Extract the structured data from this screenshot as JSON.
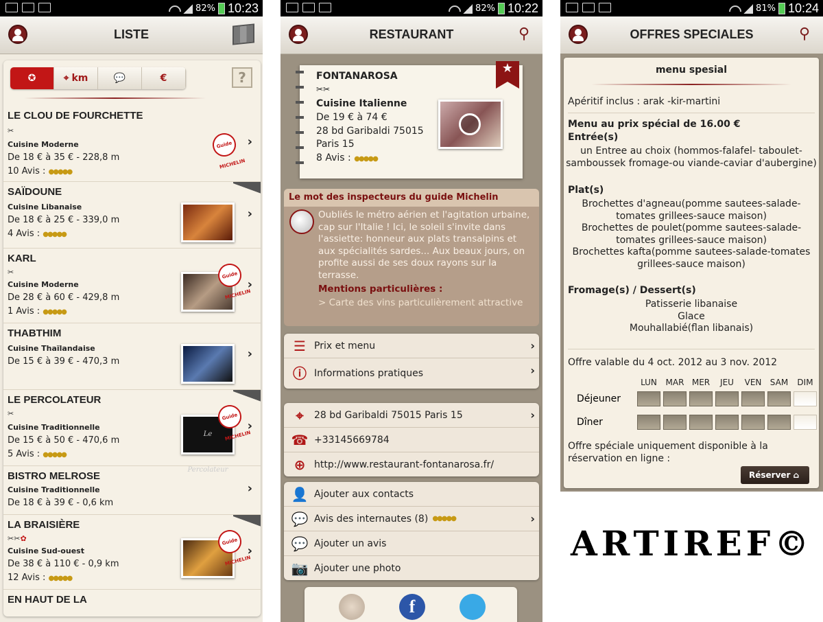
{
  "screen1": {
    "status": {
      "battery": "82%",
      "time": "10:23"
    },
    "title": "LISTE",
    "filters": {
      "distance_label": "km"
    },
    "restaurants": [
      {
        "name": "LE CLOU DE FOURCHETTE",
        "forks": "✂",
        "cuisine": "Cuisine Moderne",
        "price": "De 18 € à 35 €  - 228,8 m",
        "avis": "10 Avis :"
      },
      {
        "name": "SAÏDOUNE",
        "cuisine": "Cuisine Libanaise",
        "price": "De 18 € à 25 €  - 339,0 m",
        "avis": "4 Avis :"
      },
      {
        "name": "KARL",
        "forks": "✂",
        "cuisine": "Cuisine Moderne",
        "price": "De 28 € à 60 €  - 429,8 m",
        "avis": "1 Avis :"
      },
      {
        "name": "THABTHIM",
        "cuisine": "Cuisine Thaïlandaise",
        "price": "De 15 € à 39 €  - 470,3 m"
      },
      {
        "name": "LE PERCOLATEUR",
        "forks": "✂",
        "cuisine": "Cuisine Traditionnelle",
        "price": "De 15 € à 50 €  - 470,6 m",
        "avis": "5 Avis :",
        "thumb_text": "Le Percolateur"
      },
      {
        "name": "BISTRO MELROSE",
        "cuisine": "Cuisine Traditionnelle",
        "price": "De 18 € à 39 €  - 0,6 km"
      },
      {
        "name": "LA BRAISIÈRE",
        "forks": "✂✂",
        "cuisine": "Cuisine Sud-ouest",
        "price": "De 38 € à 110 €  - 0,9 km",
        "avis": "12 Avis :"
      },
      {
        "name": "EN HAUT DE LA"
      }
    ],
    "michelin_label": "Guide MICHELIN"
  },
  "screen2": {
    "status": {
      "battery": "82%",
      "time": "10:22"
    },
    "title": "RESTAURANT",
    "card": {
      "name": "FONTANAROSA",
      "forks": "✂✂",
      "cuisine": "Cuisine Italienne",
      "price": "De 19 € à 74 €",
      "address1": "28 bd Garibaldi 75015",
      "address2": "Paris 15",
      "avis": "8 Avis :"
    },
    "inspect": {
      "header": "Le mot des inspecteurs du guide Michelin",
      "text": "Oubliés le métro aérien et l'agitation urbaine, cap sur l'Italie ! Ici, le soleil s'invite dans l'assiette: honneur aux plats transalpins et aux spécialités sardes... Aux beaux jours, on profite aussi de ses doux rayons sur la terrasse.",
      "mentions_title": "Mentions particulières :",
      "mention": "> Carte des vins particulièrement attractive"
    },
    "menu_rows": [
      "Prix et menu",
      "Informations pratiques"
    ],
    "contact_rows": [
      "28 bd Garibaldi 75015 Paris 15",
      "+33145669784",
      "http://www.restaurant-fontanarosa.fr/"
    ],
    "action_rows": [
      "Ajouter aux contacts",
      "Avis des internautes (8)",
      "Ajouter un avis",
      "Ajouter une photo"
    ]
  },
  "screen3": {
    "status": {
      "battery": "81%",
      "time": "10:24"
    },
    "title": "OFFRES SPECIALES",
    "menu_title": "menu spesial",
    "aperitif": "Apéritif inclus : arak -kir-martini",
    "menu_price": "Menu au prix spécial de 16.00 €",
    "entrees_title": "Entrée(s)",
    "entrees": [
      "un Entree au choix (hommos-falafel- taboulet-",
      "samboussek fromage-ou viande-caviar d'aubergine)"
    ],
    "plats_title": "Plat(s)",
    "plats": [
      "Brochettes d'agneau(pomme sautees-salade-",
      "tomates grillees-sauce maison)",
      "Brochettes de poulet(pomme sautees-salade-",
      "tomates grillees-sauce maison)",
      "Brochettes kafta(pomme sautees-salade-tomates",
      "grillees-sauce maison)"
    ],
    "desserts_title": "Fromage(s) / Dessert(s)",
    "desserts": [
      "Patisserie libanaise",
      "Glace",
      "Mouhallabié(flan libanais)"
    ],
    "validity": "Offre valable du 4 oct. 2012 au 3 nov. 2012",
    "days": [
      "LUN",
      "MAR",
      "MER",
      "JEU",
      "VEN",
      "SAM",
      "DIM"
    ],
    "meals": [
      "Déjeuner",
      "Dîner"
    ],
    "note": "Offre spéciale uniquement disponible à la réservation en ligne :",
    "reserve_label": "Réserver"
  },
  "watermark": "ARTIREF©",
  "colors": {
    "accent": "#c21616",
    "dark_red": "#7b1e1e",
    "panel": "#f6f1e6",
    "frame": "#9b9181"
  }
}
